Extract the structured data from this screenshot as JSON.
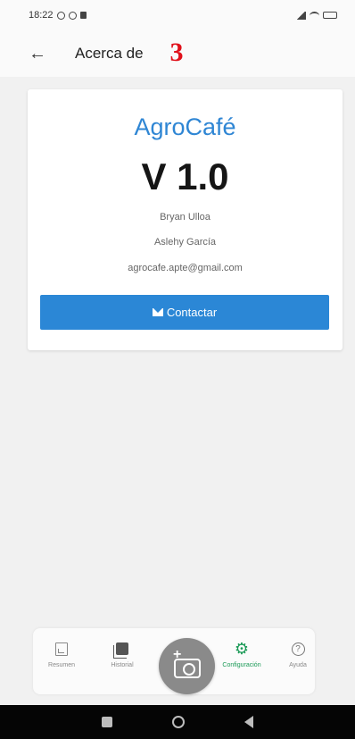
{
  "status_bar": {
    "time": "18:22",
    "right_text": "..ıl ⇆ ▭"
  },
  "app_bar": {
    "title": "Acerca de",
    "step_marker": "3"
  },
  "about": {
    "app_name": "AgroCafé",
    "version": "V 1.0",
    "authors": [
      "Bryan Ulloa",
      "Aslehy García"
    ],
    "email": "agrocafe.apte@gmail.com",
    "contact_button": "Contactar"
  },
  "bottom_nav": {
    "items": [
      {
        "label": "Resumen",
        "icon": "summary-icon"
      },
      {
        "label": "Historial",
        "icon": "history-icon"
      },
      {
        "label": "Configuración",
        "icon": "gear-icon",
        "active": true
      },
      {
        "label": "Ayuda",
        "icon": "help-icon"
      }
    ],
    "fab_icon": "add-camera-icon"
  },
  "colors": {
    "brand_blue": "#2f86d4",
    "button_blue": "#2b87d6",
    "active_green": "#1b9a57",
    "step_red": "#e0101a"
  }
}
